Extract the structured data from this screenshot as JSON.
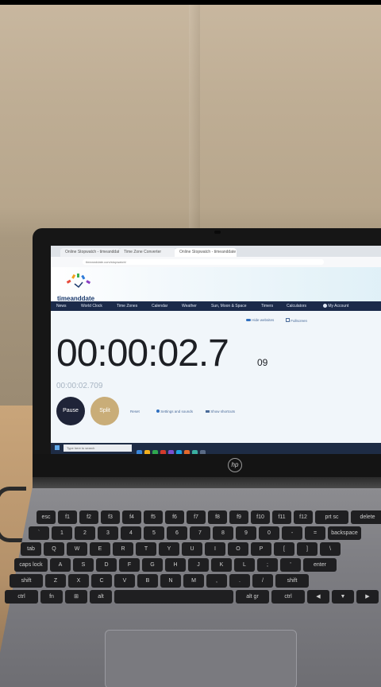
{
  "browser": {
    "tabs": [
      "Online Stopwatch - timeanddate",
      "Time Zone Converter",
      "Online Stopwatch - timeanddate"
    ],
    "url": "timeanddate.com/stopwatch/"
  },
  "site": {
    "logo_text": "timeanddate",
    "nav": [
      "News",
      "World Clock",
      "Time Zones",
      "Calendar",
      "Weather",
      "Sun, Moon & Space",
      "Timers",
      "Calculators",
      "My Account"
    ]
  },
  "stopwatch": {
    "time_main": "00:00:02.7",
    "time_ms": "09",
    "time_sub": "00:00:02.709",
    "pause_label": "Pause",
    "split_label": "Split",
    "options": [
      "Hide websites",
      "Fullscreen"
    ],
    "links": [
      "Reset",
      "Settings and sounds",
      "Show shortcuts"
    ]
  },
  "taskbar": {
    "search_placeholder": "Type here to search",
    "icon_colors": [
      "#3a86d9",
      "#f2b01e",
      "#2fa84f",
      "#d33b2c",
      "#7a4fd0",
      "#1ea1e0",
      "#e36a2c",
      "#3bb0a0",
      "#5a6b85"
    ]
  },
  "laptop": {
    "brand": "hp"
  },
  "keyboard": {
    "row1": [
      "esc",
      "f1",
      "f2",
      "f3",
      "f4",
      "f5",
      "f6",
      "f7",
      "f8",
      "f9",
      "f10",
      "f11",
      "f12",
      "prt sc",
      "delete"
    ],
    "row2": [
      "`",
      "1",
      "2",
      "3",
      "4",
      "5",
      "6",
      "7",
      "8",
      "9",
      "0",
      "-",
      "=",
      "backspace"
    ],
    "row3": [
      "tab",
      "Q",
      "W",
      "E",
      "R",
      "T",
      "Y",
      "U",
      "I",
      "O",
      "P",
      "[",
      "]",
      "\\"
    ],
    "row4": [
      "caps lock",
      "A",
      "S",
      "D",
      "F",
      "G",
      "H",
      "J",
      "K",
      "L",
      ";",
      "'",
      "enter"
    ],
    "row5": [
      "shift",
      "Z",
      "X",
      "C",
      "V",
      "B",
      "N",
      "M",
      ",",
      ".",
      "/",
      "shift"
    ],
    "row6": [
      "ctrl",
      "fn",
      "⊞",
      "alt",
      "",
      "alt gr",
      "ctrl",
      "◀",
      "▼",
      "▶"
    ]
  }
}
